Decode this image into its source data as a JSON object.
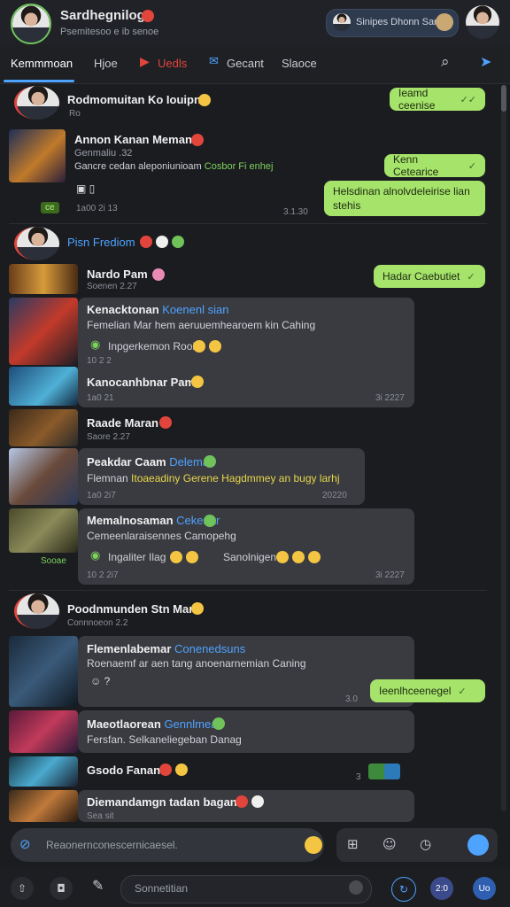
{
  "header": {
    "title": "Sardhegnilog",
    "subtitle": "Psemitesoo e ib senoe",
    "profile_pill": "Sinipes Dhonn Sane"
  },
  "tabs": [
    {
      "label": "Kemmmoan",
      "active": true
    },
    {
      "label": "Hjoe",
      "active": false
    },
    {
      "label": "Uedls",
      "active": false
    },
    {
      "label": "Gecant",
      "active": false
    },
    {
      "label": "Slaoce",
      "active": false
    }
  ],
  "chats": {
    "section1": {
      "name": "Rodmomuitan Ko Iouipn",
      "sub": "Ro"
    },
    "sent1": "Ieamd ceenise",
    "msg1": {
      "name": "Annon Kanan Meman",
      "line1": "Genmaliu .32",
      "line2": "Gancre cedan aleponiunioam",
      "line2_green": "Cosbor Fi enhej",
      "time": "1a00 2i 13",
      "badge": "ce"
    },
    "sent2": "Kenn Cetearice",
    "sent3": "Helsdinan alnolvdeleirise lian stehis",
    "sent3_time": "3.1.30",
    "section2": {
      "name": "Pisn Frediom"
    },
    "sent4": "Hadar Caebutiet",
    "msg2": {
      "name": "Nardo Pam",
      "line1": "Soenen 2.27"
    },
    "msg3": {
      "name": "Kenacktonan",
      "name_blue": "Koenenl sian",
      "line1": "Femelian Mar hem aeruuemhearoem kin Cahing",
      "line2": "Inpgerkemon Rooi",
      "time": "10 2 2"
    },
    "msg4": {
      "name": "Kanocanhbnar Pam",
      "time": "1a0 21",
      "time_right": "3i 2227"
    },
    "msg5": {
      "name": "Raade Maran",
      "line1": "Saore 2.27"
    },
    "msg6": {
      "name": "Peakdar Caam",
      "name_blue": "Deleman",
      "line1": "Flemnan",
      "line1_yellow": "Itoaeadiny Gerene Hagdmmey an bugy larhj",
      "time": "1a0 2i7",
      "time_right": "20220"
    },
    "msg7": {
      "name": "Memalnosaman",
      "name_blue": "Cekenar",
      "line1": "Cemeenlaraisennes Camopehg",
      "line2": "Ingaliter Ilag",
      "line2b": "Sanolnigen",
      "time": "10 2 2i7",
      "time_right": "3i 2227",
      "left_tag": "Sooae"
    },
    "section3": {
      "name": "Poodnmunden Stn Mam",
      "sub": "Connnoeon 2.2"
    },
    "msg8": {
      "name": "Flemenlabemar",
      "name_blue": "Conenedsuns",
      "line1": "Roenaemf ar aen tang anoenarnemian Caning"
    },
    "sent5": "Ieenlhceenegel",
    "sent5_time": "3.0",
    "msg9": {
      "name": "Maeotlaorean",
      "name_blue": "Gennlmean",
      "line1": "Fersfan. Selkaneliegeban Danag"
    },
    "msg10": {
      "name": "Gsodo Fanan",
      "right_time": "3"
    },
    "msg11": {
      "name": "Diemandamgn tadan bagan",
      "line1": "Sea sit"
    }
  },
  "input": {
    "placeholder": "Reaonernconescernicaesel."
  },
  "bottom": {
    "field_placeholder": "Sonnetitian",
    "btn1": "2:0",
    "btn2": "Uo"
  },
  "colors": {
    "accent": "#4ea3ff",
    "sent_bubble": "#a6e36b",
    "background": "#1b1c20"
  },
  "icons": [
    "search-icon",
    "send-icon",
    "link-icon",
    "emoji-icon",
    "clock-icon",
    "add-icon",
    "upload-icon",
    "pen-icon"
  ]
}
